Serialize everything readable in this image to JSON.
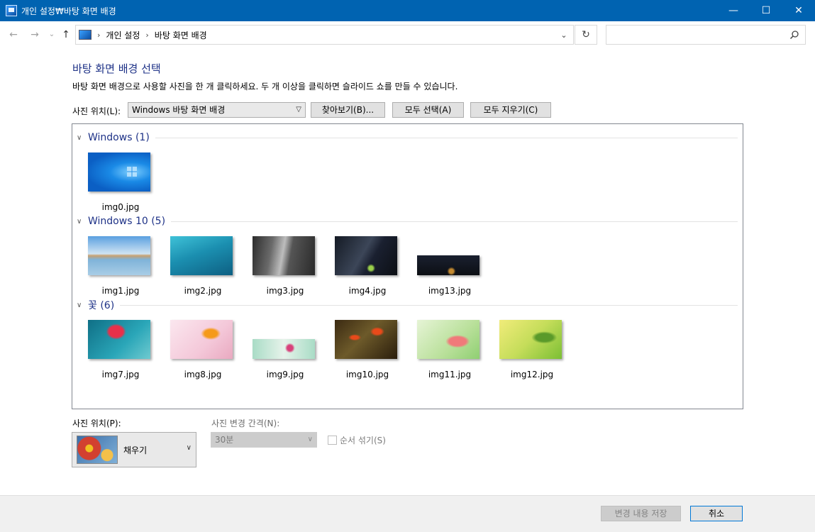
{
  "window": {
    "title": "개인 설정₩바탕 화면 배경",
    "minimize": "—",
    "maximize": "☐",
    "close": "✕"
  },
  "nav": {
    "back": "←",
    "forward": "→",
    "recent": "⌄",
    "up": "↑",
    "breadcrumb": [
      "개인 설정",
      "바탕 화면 배경"
    ],
    "separator": "›",
    "dropdown": "⌄",
    "refresh": "↻",
    "search_placeholder": ""
  },
  "main": {
    "heading": "바탕 화면 배경 선택",
    "description": "바탕 화면 배경으로 사용할 사진을 한 개 클릭하세요. 두 개 이상을 클릭하면 슬라이드 쇼를 만들 수 있습니다.",
    "location_label": "사진 위치(L):",
    "location_value": "Windows 바탕 화면 배경",
    "browse_button": "찾아보기(B)...",
    "select_all_button": "모두 선택(A)",
    "clear_all_button": "모두 지우기(C)"
  },
  "gallery": {
    "groups": [
      {
        "name": "Windows (1)",
        "items": [
          {
            "file": "img0.jpg"
          }
        ]
      },
      {
        "name": "Windows 10 (5)",
        "items": [
          {
            "file": "img1.jpg"
          },
          {
            "file": "img2.jpg"
          },
          {
            "file": "img3.jpg"
          },
          {
            "file": "img4.jpg"
          },
          {
            "file": "img13.jpg"
          }
        ]
      },
      {
        "name": "꽃 (6)",
        "items": [
          {
            "file": "img7.jpg"
          },
          {
            "file": "img8.jpg"
          },
          {
            "file": "img9.jpg"
          },
          {
            "file": "img10.jpg"
          },
          {
            "file": "img11.jpg"
          },
          {
            "file": "img12.jpg"
          }
        ]
      }
    ]
  },
  "options": {
    "position_label": "사진 위치(P):",
    "position_value": "채우기",
    "interval_label": "사진 변경 간격(N):",
    "interval_value": "30분",
    "shuffle_label": "순서 섞기(S)"
  },
  "footer": {
    "save_button": "변경 내용 저장",
    "cancel_button": "취소"
  },
  "colors": {
    "titlebar": "#0063b1",
    "heading": "#1e3287"
  }
}
